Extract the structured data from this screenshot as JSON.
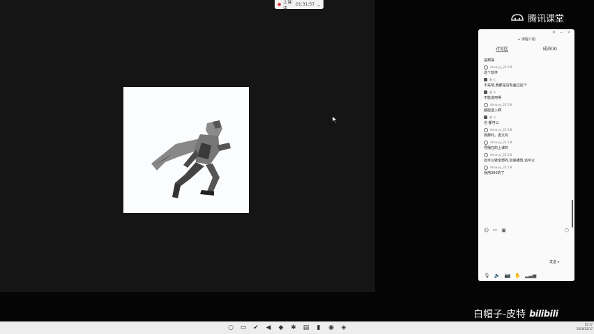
{
  "live": {
    "status": "上课中",
    "time": "01:31:57"
  },
  "brand": {
    "name": "腾讯课堂"
  },
  "chat": {
    "intro": "+ 课程介绍",
    "tabs": [
      {
        "label": "讨论区",
        "active": true
      },
      {
        "label": "成员(8)",
        "active": false
      }
    ],
    "messages": [
      {
        "type": "text",
        "text": "是啊得"
      },
      {
        "type": "user",
        "name": "Anna-yy_23 5:8"
      },
      {
        "type": "text",
        "text": "这个软件"
      },
      {
        "type": "teacher",
        "name": "老 七"
      },
      {
        "type": "text",
        "text": "不是吧,我都是没有画过这个"
      },
      {
        "type": "teacher",
        "name": "老 七"
      },
      {
        "type": "text",
        "text": "不能说用得"
      },
      {
        "type": "user",
        "name": "Anna-yy_23 5:8"
      },
      {
        "type": "text",
        "text": "都能送入啊"
      },
      {
        "type": "teacher",
        "name": "老 七"
      },
      {
        "type": "text",
        "text": "也 都可以"
      },
      {
        "type": "user",
        "name": "Anna-yy_23 5:8"
      },
      {
        "type": "text",
        "text": "我那时。唐文的"
      },
      {
        "type": "user",
        "name": "Anna-yy_23 5:8"
      },
      {
        "type": "text",
        "text": "导播在的上课的"
      },
      {
        "type": "user",
        "name": "Anna-yy_23 5:8"
      },
      {
        "type": "text",
        "text": "还可以做全部的,加速播放,还可以"
      },
      {
        "type": "user",
        "name": "Anna-yy_23 5:8"
      },
      {
        "type": "text",
        "text": "我用300的了"
      }
    ],
    "send_label": "发送 ▾"
  },
  "watermark": {
    "author": "白帽子-皮特",
    "site": "bilibili"
  },
  "clock": {
    "time": "15:17",
    "date": "2020/12/17"
  }
}
